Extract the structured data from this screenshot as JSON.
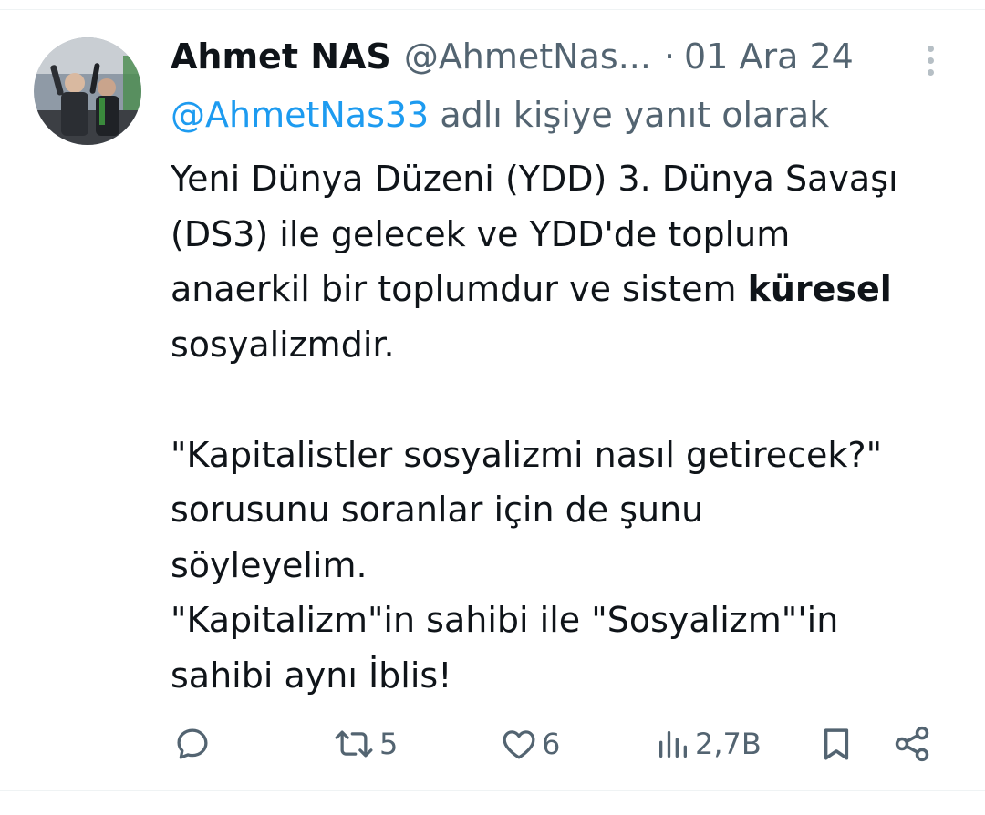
{
  "tweet": {
    "author_name": "Ahmet NAS",
    "author_handle": "@AhmetNas...",
    "separator": "·",
    "date": "01 Ara 24",
    "reply_mention": "@AhmetNas33",
    "reply_suffix": " adlı kişiye yanıt olarak",
    "body": {
      "line1": "Yeni Dünya Düzeni (YDD) 3. Dünya Savaşı",
      "line2": "(DS3) ile gelecek ve YDD'de toplum",
      "line3_start": "anaerkil bir toplumdur ve sistem ",
      "line3_bold": "küresel",
      "line4": "sosyalizmdir.",
      "line5": "\"Kapitalistler sosyalizmi nasıl getirecek?\"",
      "line6": "sorusunu soranlar için de şunu",
      "line7": "söyleyelim.",
      "line8": "\"Kapitalizm\"in sahibi ile \"Sosyalizm\"'in",
      "line9": "sahibi aynı İblis!"
    }
  },
  "actions": {
    "reply_icon": "reply-icon",
    "retweet_icon": "retweet-icon",
    "retweet_count": "5",
    "like_icon": "heart-icon",
    "like_count": "6",
    "views_icon": "views-icon",
    "views_count": "2,7B",
    "bookmark_icon": "bookmark-icon",
    "share_icon": "share-icon"
  },
  "colors": {
    "text": "#0f1419",
    "secondary": "#536471",
    "link": "#1d9bf0",
    "divider": "#eff3f4"
  }
}
